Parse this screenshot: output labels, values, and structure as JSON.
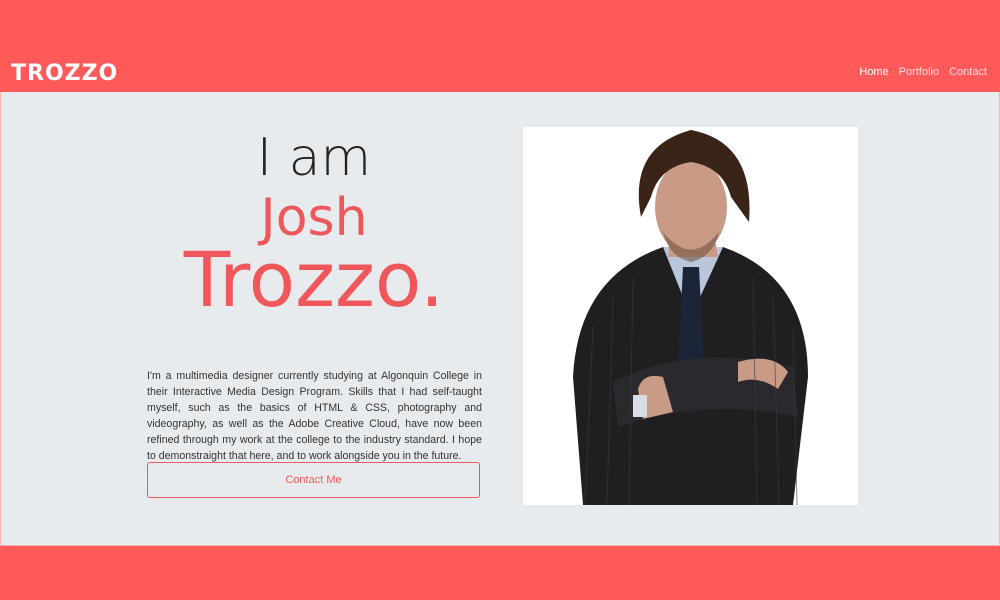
{
  "header": {
    "logo": "TROZZO",
    "nav": [
      {
        "label": "Home",
        "active": true
      },
      {
        "label": "Portfolio",
        "active": false
      },
      {
        "label": "Contact",
        "active": false
      }
    ]
  },
  "hero": {
    "line1": "I am",
    "first_name": "Josh",
    "last_name": "Trozzo."
  },
  "bio": "I'm a multimedia designer currently studying at Algonquin College in their Interactive Media Design Program. Skills that I had self-taught myself, such as the basics of HTML & CSS, photography and videography, as well as the Adobe Creative Cloud, have now been refined through my work at the college to the industry standard. I hope to demonstraight that here, and to work alongside you in the future.",
  "cta": {
    "label": "Contact Me"
  },
  "colors": {
    "accent": "#f0575a",
    "header_bg": "#ff5a5a",
    "main_bg": "#e8ebee"
  }
}
